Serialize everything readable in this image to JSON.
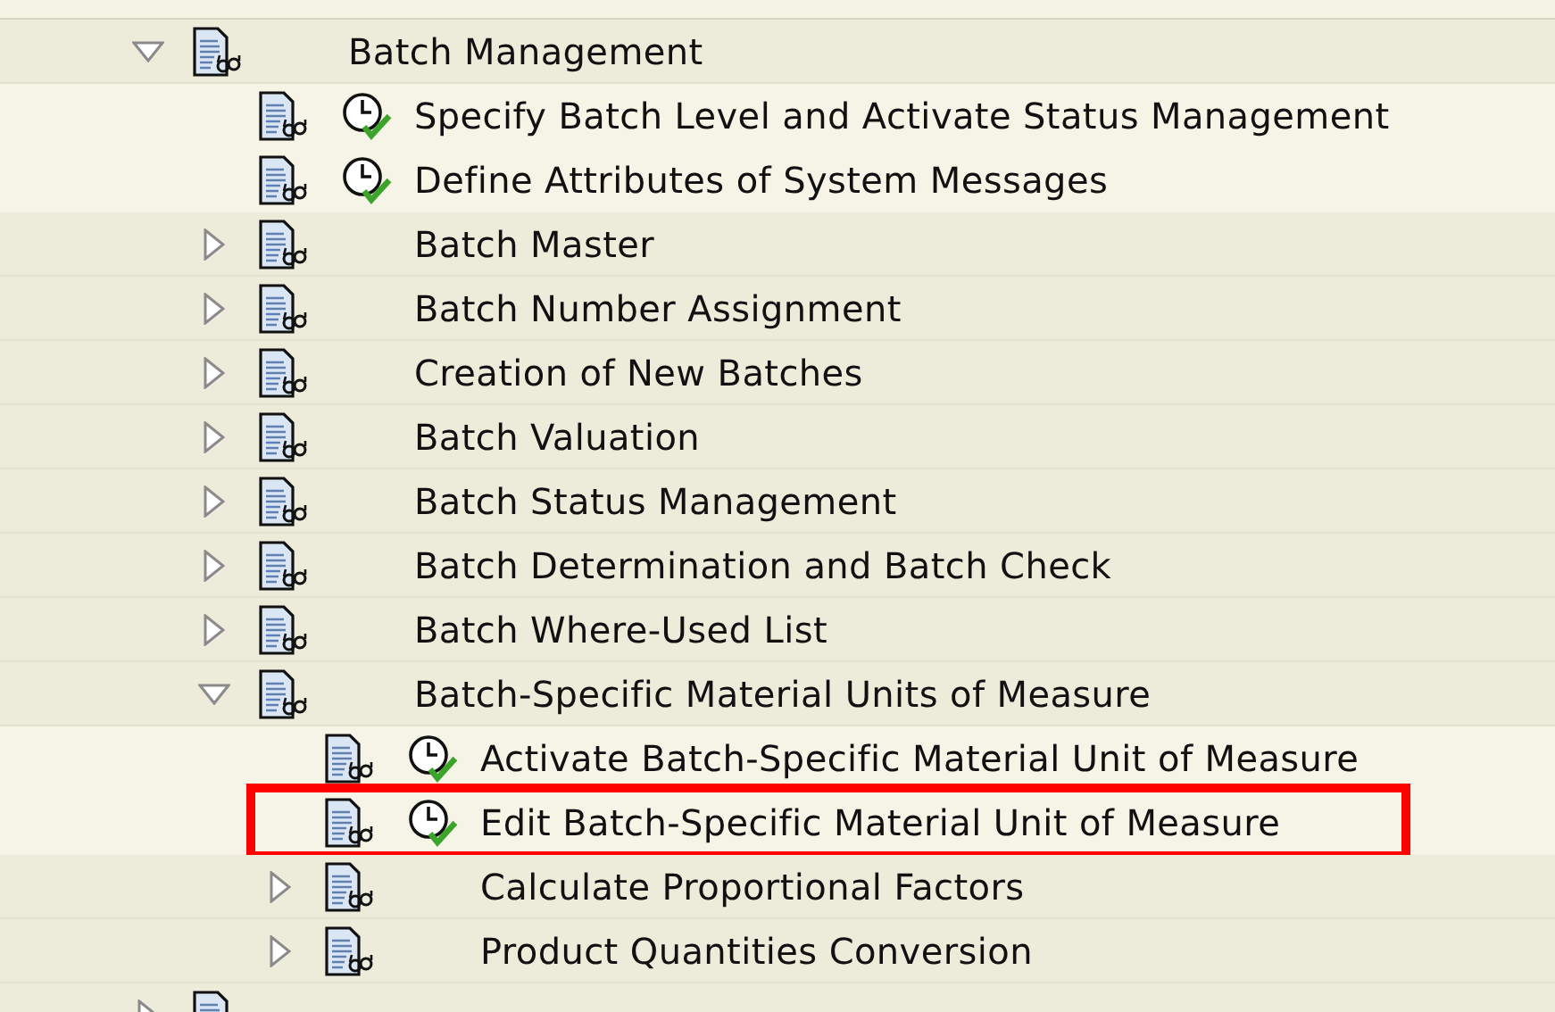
{
  "tree": [
    {
      "label": "Batch Management",
      "kind": "node",
      "expanded": true,
      "highlighted": false,
      "children": [
        {
          "label": "Specify Batch Level and Activate Status Management",
          "kind": "activity",
          "highlighted": false
        },
        {
          "label": "Define Attributes of System Messages",
          "kind": "activity",
          "highlighted": false
        },
        {
          "label": "Batch Master",
          "kind": "node",
          "expanded": false,
          "highlighted": false
        },
        {
          "label": "Batch Number Assignment",
          "kind": "node",
          "expanded": false,
          "highlighted": false
        },
        {
          "label": "Creation of New Batches",
          "kind": "node",
          "expanded": false,
          "highlighted": false
        },
        {
          "label": "Batch Valuation",
          "kind": "node",
          "expanded": false,
          "highlighted": false
        },
        {
          "label": "Batch Status Management",
          "kind": "node",
          "expanded": false,
          "highlighted": false
        },
        {
          "label": "Batch Determination and Batch Check",
          "kind": "node",
          "expanded": false,
          "highlighted": false
        },
        {
          "label": "Batch Where-Used List",
          "kind": "node",
          "expanded": false,
          "highlighted": false
        },
        {
          "label": "Batch-Specific Material Units of Measure",
          "kind": "node",
          "expanded": true,
          "highlighted": false,
          "children": [
            {
              "label": "Activate Batch-Specific Material Unit of Measure",
              "kind": "activity",
              "highlighted": false
            },
            {
              "label": "Edit Batch-Specific Material Unit of Measure",
              "kind": "activity",
              "highlighted": true
            },
            {
              "label": "Calculate Proportional Factors",
              "kind": "node",
              "expanded": false,
              "highlighted": false
            },
            {
              "label": "Product Quantities Conversion",
              "kind": "node",
              "expanded": false,
              "highlighted": false
            }
          ]
        }
      ]
    },
    {
      "kind": "node",
      "expanded": false,
      "highlighted": false
    }
  ]
}
